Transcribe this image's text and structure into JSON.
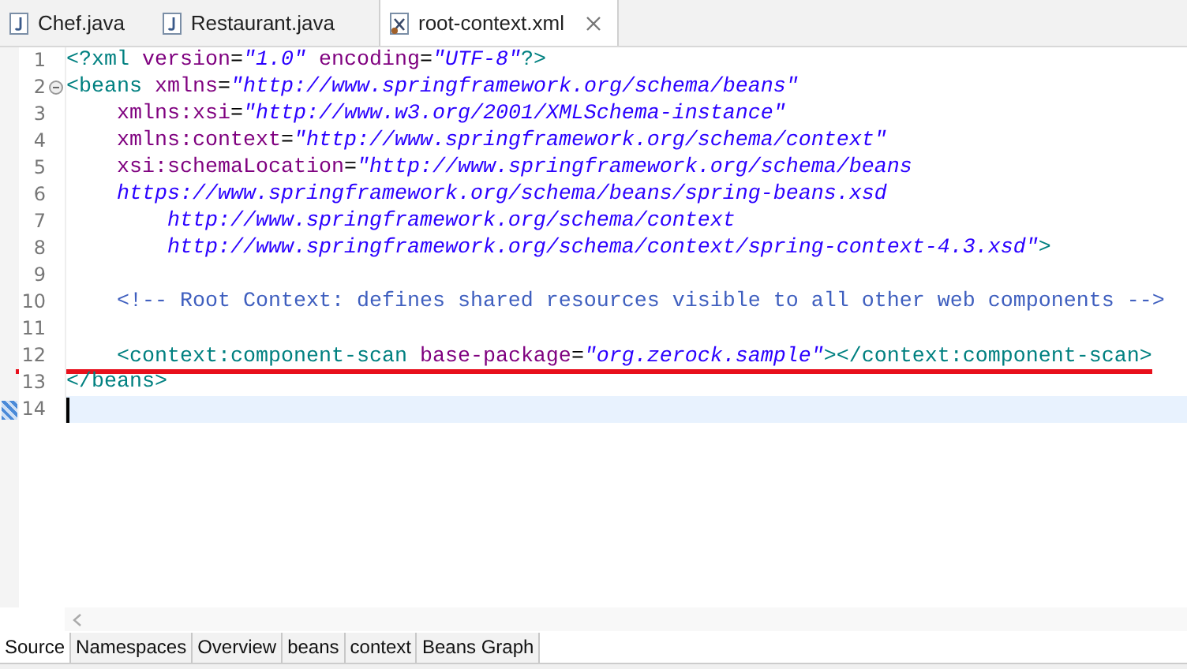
{
  "editor_tabs": [
    {
      "label": "Chef.java",
      "kind": "java",
      "selected": false,
      "closable": false
    },
    {
      "label": "Restaurant.java",
      "kind": "java",
      "selected": false,
      "closable": false
    },
    {
      "label": "root-context.xml",
      "kind": "xml",
      "selected": true,
      "closable": true
    }
  ],
  "code_lines": [
    {
      "number": "1",
      "tokens": [
        {
          "kind": "tag",
          "text": "<?xml "
        },
        {
          "kind": "attr",
          "text": "version"
        },
        {
          "kind": "eq",
          "text": "="
        },
        {
          "kind": "value",
          "text": "\"1.0\""
        },
        {
          "kind": "attr",
          "text": " encoding"
        },
        {
          "kind": "eq",
          "text": "="
        },
        {
          "kind": "value",
          "text": "\"UTF-8\""
        },
        {
          "kind": "tag",
          "text": "?>"
        }
      ]
    },
    {
      "number": "2",
      "expanded": true,
      "tokens": [
        {
          "kind": "tag",
          "text": "<beans "
        },
        {
          "kind": "attr",
          "text": "xmlns"
        },
        {
          "kind": "eq",
          "text": "="
        },
        {
          "kind": "value",
          "text": "\"http://www.springframework.org/schema/beans\""
        }
      ]
    },
    {
      "number": "3",
      "tokens": [
        {
          "kind": "attr",
          "text": "    xmlns:xsi"
        },
        {
          "kind": "eq",
          "text": "="
        },
        {
          "kind": "value",
          "text": "\"http://www.w3.org/2001/XMLSchema-instance\""
        }
      ]
    },
    {
      "number": "4",
      "tokens": [
        {
          "kind": "attr",
          "text": "    xmlns:context"
        },
        {
          "kind": "eq",
          "text": "="
        },
        {
          "kind": "value",
          "text": "\"http://www.springframework.org/schema/context\""
        }
      ]
    },
    {
      "number": "5",
      "tokens": [
        {
          "kind": "attr",
          "text": "    xsi:schemaLocation"
        },
        {
          "kind": "eq",
          "text": "="
        },
        {
          "kind": "value",
          "text": "\"http://www.springframework.org/schema/beans"
        }
      ]
    },
    {
      "number": "6",
      "tokens": [
        {
          "kind": "value",
          "text": "    https://www.springframework.org/schema/beans/spring-beans.xsd"
        }
      ]
    },
    {
      "number": "7",
      "tokens": [
        {
          "kind": "value",
          "text": "        http://www.springframework.org/schema/context"
        }
      ]
    },
    {
      "number": "8",
      "tokens": [
        {
          "kind": "value",
          "text": "        http://www.springframework.org/schema/context/spring-context-4.3.xsd\""
        },
        {
          "kind": "tag",
          "text": ">"
        }
      ]
    },
    {
      "number": "9"
    },
    {
      "number": "10",
      "tokens": [
        {
          "kind": "comment",
          "text": "    <!-- Root Context: defines shared resources visible to all other web components -->"
        }
      ]
    },
    {
      "number": "11"
    },
    {
      "number": "12",
      "underlined": true,
      "tokens": [
        {
          "kind": "tag",
          "text": "    <context:component-scan "
        },
        {
          "kind": "attr",
          "text": "base-package"
        },
        {
          "kind": "eq",
          "text": "="
        },
        {
          "kind": "value",
          "text": "\"org.zerock.sample\""
        },
        {
          "kind": "tag",
          "text": "></context:component-scan>"
        }
      ]
    },
    {
      "number": "13",
      "tokens": [
        {
          "kind": "tag",
          "text": "</beans>"
        }
      ]
    },
    {
      "number": "14",
      "current": true,
      "marker": true
    }
  ],
  "page_tabs": [
    {
      "label": "Source",
      "selected": true
    },
    {
      "label": "Namespaces",
      "selected": false
    },
    {
      "label": "Overview",
      "selected": false
    },
    {
      "label": "beans",
      "selected": false
    },
    {
      "label": "context",
      "selected": false
    },
    {
      "label": "Beans Graph",
      "selected": false
    }
  ]
}
